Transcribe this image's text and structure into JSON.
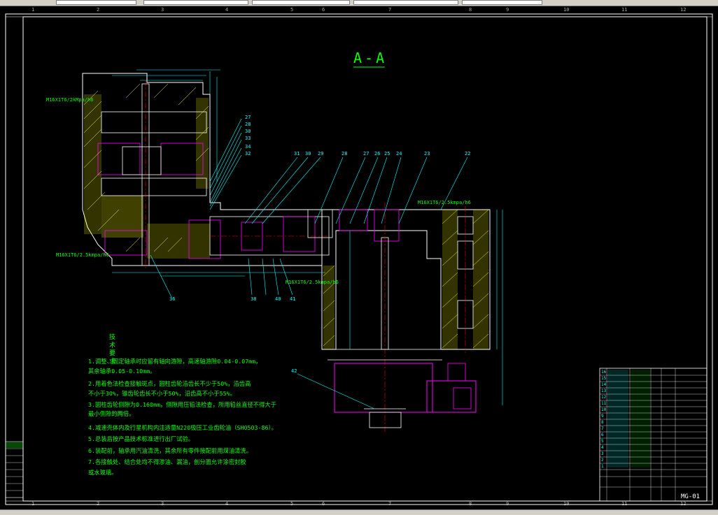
{
  "drawing": {
    "section_title": "A-A",
    "drawing_number": "MG-01",
    "colors": {
      "background": "#000000",
      "outline": "#ffffff",
      "dimension": "#00ffff",
      "text": "#00ff00",
      "hatch": "#ffff00",
      "motor": "#ff00ff",
      "centerline": "#ff0000"
    }
  },
  "rulers": {
    "top": [
      "1",
      "2",
      "3",
      "4",
      "5",
      "6",
      "7",
      "8",
      "9",
      "10",
      "11",
      "12"
    ],
    "bottom": [
      "1",
      "2",
      "3",
      "4",
      "5",
      "6",
      "7",
      "8",
      "9",
      "10",
      "11",
      "12"
    ]
  },
  "tech_requirements": {
    "heading": "技术要求",
    "items": [
      "1.调整、固定轴承时应留有轴向游隙，高速轴游隙0.04-0.07mm，",
      "  其余轴承0.05-0.10mm。",
      "2.用着色法检查接触斑点，圆柱齿轮沿齿长不少于50%，沿齿高",
      "  不小于30%，锥齿轮齿长不小于50%，沿齿高不小于55%。",
      "3.圆柱齿轮侧隙为0.160mm，侧隙用压铅法检查，所用铅丝直径不得大于",
      "  最小侧隙的两倍。",
      "4.减速壳体内及行星机构内注适量N220极压工业齿轮油（SH0503-86）。",
      "5.总装后按产品技术标准进行出厂试验。",
      "6.装配前，轴承用汽油清洗，其余所有零件按配前用煤油清洗。",
      "7.各接触处、结合处均不得渗油、漏油，剖分面允许涂密封胶",
      "  或水玻璃。"
    ]
  },
  "callouts": {
    "numbers": [
      "27",
      "28",
      "30",
      "33",
      "34",
      "32",
      "31",
      "30",
      "29",
      "28",
      "27",
      "26",
      "25",
      "24",
      "23",
      "22",
      "36",
      "38",
      "40",
      "41",
      "42"
    ],
    "fits": [
      "M16X1T6/2kMpa/h6",
      "M16X1T6/2.5kmpa/h6",
      "M16X1T6/2.5kmpa/h6",
      "M16X1T6/2.5kmpa/h6"
    ]
  },
  "title_block": {
    "rows": [
      "16",
      "15",
      "14",
      "13",
      "12",
      "11",
      "10",
      "9",
      "8",
      "7",
      "6",
      "5",
      "4",
      "3",
      "2",
      "1"
    ]
  }
}
